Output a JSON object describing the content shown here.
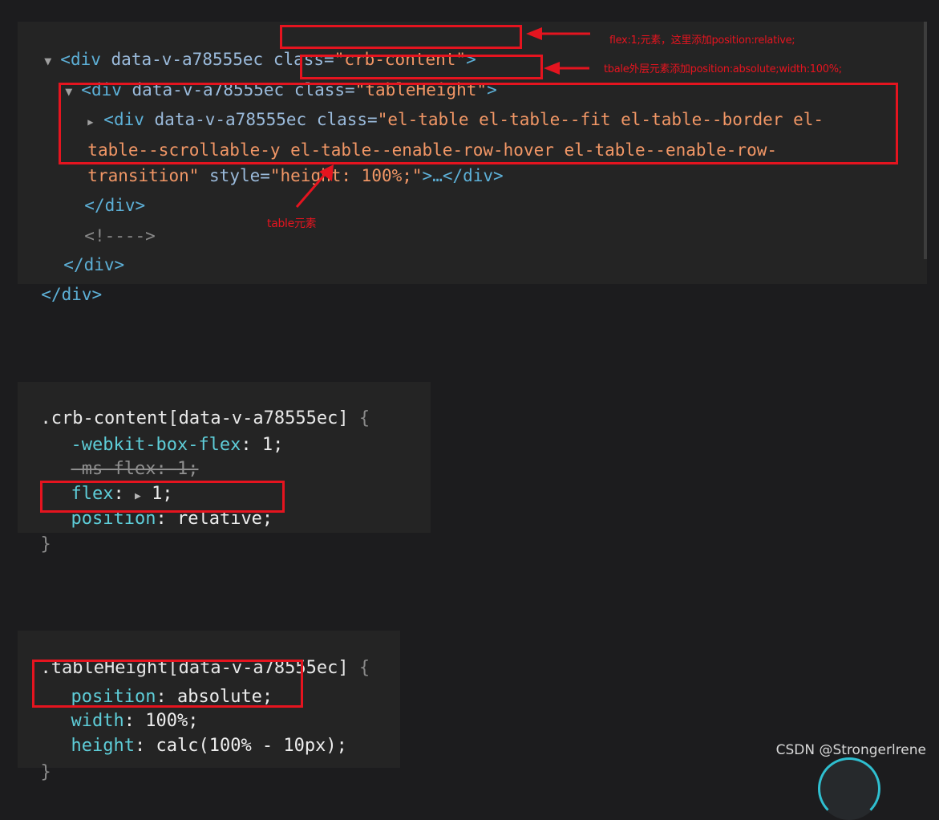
{
  "elements": {
    "lines": [
      {
        "open": "<div",
        "attr": "data-v-a78555ec",
        "cls_attr": "class=",
        "cls_val": "\"crb-content\"",
        "close": ">"
      },
      {
        "open": "<div",
        "attr": "data-v-a78555ec",
        "cls_attr": "class=",
        "cls_val": "\"tableHeight\"",
        "close": ">"
      },
      {
        "open": "<div",
        "attr": "data-v-a78555ec",
        "cls_attr": "class=",
        "cls_val": "\"el-table el-table--fit el-table--border el-"
      },
      {
        "cont": "table--scrollable-y el-table--enable-row-hover el-table--enable-row-"
      },
      {
        "cont": "transition\"",
        "style_attr": "style=",
        "style_val": "\"height: 100%;\"",
        "tail": ">…</div>"
      },
      {
        "close_tag": "</div>"
      },
      {
        "comment": "<!---->"
      },
      {
        "close_tag": "</div>"
      },
      {
        "close_tag": "</div>"
      }
    ],
    "triangles": {
      "expanded": "▼",
      "collapsed": "▶"
    }
  },
  "annotations": {
    "crb_content": "flex:1;元素，这里添加position:relative;",
    "table_height": "tbale外层元素添加position:absolute;width:100%;",
    "table_element": "table元素"
  },
  "rules": [
    {
      "selector": ".crb-content[data-v-a78555ec]",
      "open_brace": "{",
      "close_brace": "}",
      "declarations": [
        {
          "prop": "-webkit-box-flex",
          "value": "1;"
        },
        {
          "prop": "-ms-flex",
          "value": "1;",
          "struck": true
        },
        {
          "prop": "flex",
          "value": "1;",
          "expander": "▶"
        },
        {
          "prop": "position",
          "value": "relative;"
        }
      ]
    },
    {
      "selector": ".tableHeight[data-v-a78555ec]",
      "open_brace": "{",
      "close_brace": "}",
      "declarations": [
        {
          "prop": "position",
          "value": "absolute;"
        },
        {
          "prop": "width",
          "value": "100%;"
        },
        {
          "prop": "height",
          "value": "calc(100% - 10px);"
        }
      ]
    }
  ],
  "watermark": "CSDN @Strongerlrene",
  "colors": {
    "annotation_red": "#e5141f",
    "tag_blue": "#5db0d7",
    "value_orange": "#f29766",
    "property_cyan": "#5ecdd8"
  }
}
